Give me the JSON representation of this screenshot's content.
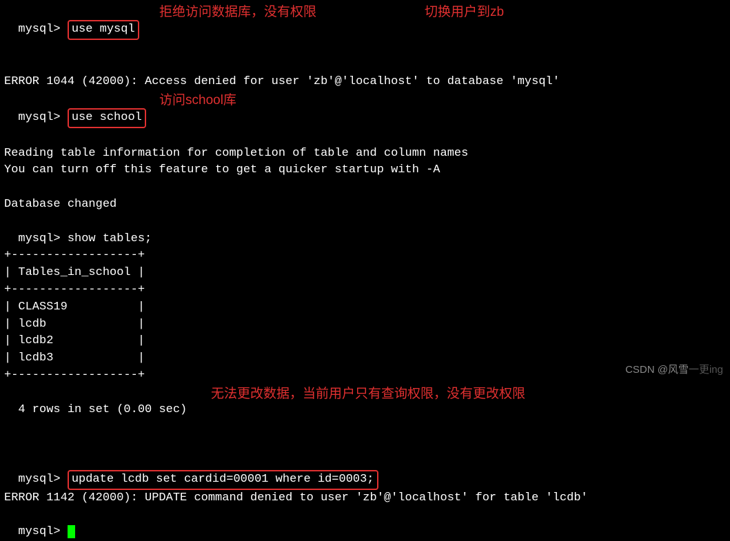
{
  "prompt": "mysql> ",
  "cmd1": "use mysql",
  "anno1": "拒绝访问数据库，没有权限",
  "anno1b": "切换用户到zb",
  "err1": "ERROR 1044 (42000): Access denied for user 'zb'@'localhost' to database 'mysql'",
  "cmd2": "use school",
  "anno2": "访问school库",
  "read1": "Reading table information for completion of table and column names",
  "read2": "You can turn off this feature to get a quicker startup with -A",
  "dbchanged": "Database changed",
  "cmd3": "show tables;",
  "tbl_border": "+------------------+",
  "tbl_header": "| Tables_in_school |",
  "tbl_rows": [
    "| CLASS19          |",
    "| lcdb             |",
    "| lcdb2            |",
    "| lcdb3            |"
  ],
  "rowcount": "4 rows in set (0.00 sec)",
  "anno3": "无法更改数据，当前用户只有查询权限，没有更改权限",
  "cmd4": "update lcdb set cardid=00001 where id=0003;",
  "err2": "ERROR 1142 (42000): UPDATE command denied to user 'zb'@'localhost' for table 'lcdb'",
  "watermark_main": "CSDN @风雪",
  "watermark_faint": "一更ing"
}
